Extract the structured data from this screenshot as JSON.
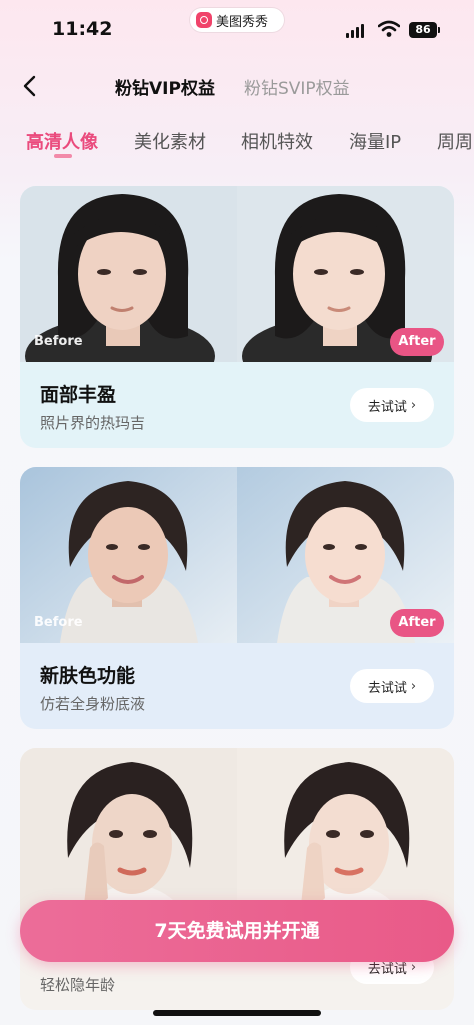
{
  "status_bar": {
    "time": "11:42",
    "app_pill": "美图秀秀",
    "battery": "86"
  },
  "nav": {
    "tabs": [
      {
        "label": "粉钻VIP权益",
        "active": true
      },
      {
        "label": "粉钻SVIP权益",
        "active": false
      }
    ]
  },
  "categories": {
    "items": [
      {
        "label": "高清人像",
        "active": true
      },
      {
        "label": "美化素材",
        "active": false
      },
      {
        "label": "相机特效",
        "active": false
      },
      {
        "label": "海量IP",
        "active": false
      },
      {
        "label": "周周",
        "active": false
      }
    ],
    "accent_color": "#ea4b7d"
  },
  "cards": [
    {
      "title": "面部丰盈",
      "subtitle": "照片界的热玛吉",
      "before_label": "Before",
      "after_label": "After",
      "button": "去试试"
    },
    {
      "title": "新肤色功能",
      "subtitle": "仿若全身粉底液",
      "before_label": "Before",
      "after_label": "After",
      "button": "去试试"
    },
    {
      "title": "",
      "subtitle": "轻松隐年龄",
      "before_label": "",
      "after_label": "",
      "button": "去试试"
    }
  ],
  "cta": {
    "label": "7天免费试用并开通",
    "color": "#e95a88"
  }
}
